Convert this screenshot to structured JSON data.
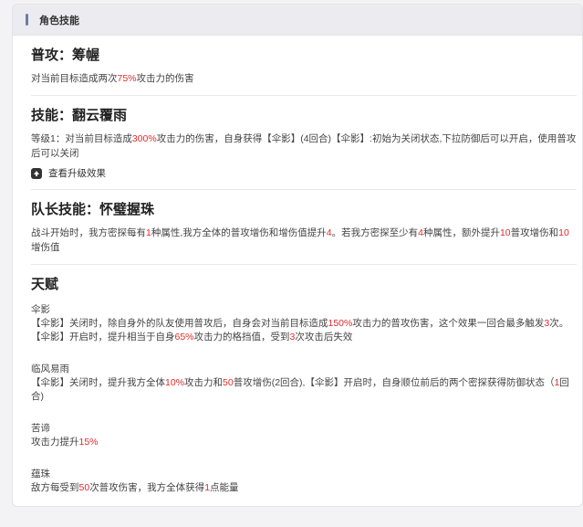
{
  "header": {
    "title": "角色技能"
  },
  "colors": {
    "highlight": "#e02b2b",
    "header_bar": "#6d7ca6"
  },
  "normal_attack": {
    "title": "普攻：筹幄",
    "desc": [
      "对当前目标造成两次",
      "75%",
      "攻击力的伤害"
    ]
  },
  "skill": {
    "title": "技能：翻云覆雨",
    "desc": [
      "等级1：对当前目标造成",
      "300%",
      "攻击力的伤害，自身获得【伞影】(4回合)【伞影】:初始为关闭状态,下拉防御后可以开启，使用普攻后可以关闭"
    ],
    "upgrade_label": "查看升级效果",
    "upgrade_icon": "arrow-up-icon"
  },
  "leader": {
    "title": "队长技能：怀璧握珠",
    "desc": [
      "战斗开始时，我方密探每有",
      "1",
      "种属性,我方全体的普攻增伤和增伤值提升",
      "4",
      "。若我方密探至少有",
      "4",
      "种属性，额外提升",
      "10",
      "普攻增伤和",
      "10",
      "增伤值"
    ]
  },
  "talents": {
    "title": "天赋",
    "items": [
      {
        "name": "伞影",
        "line1": [
          "【伞影】关闭时，除自身外的队友使用普攻后，自身会对当前目标造成",
          "150%",
          "攻击力的普攻伤害，这个效果一回合最多触发",
          "3",
          "次。"
        ],
        "line2": [
          "【伞影】开启时，提升相当于自身",
          "65%",
          "攻击力的格挡值，受到",
          "3",
          "次攻击后失效"
        ]
      },
      {
        "name": "临风易雨",
        "line1": [
          "【伞影】关闭时，提升我方全体",
          "10%",
          "攻击力和",
          "50",
          "普攻增伤(2回合),【伞影】开启时，自身顺位前后的两个密探获得防御状态（",
          "1",
          "回合)"
        ]
      },
      {
        "name": "苦谛",
        "line1": [
          "攻击力提升",
          "15%"
        ]
      },
      {
        "name": "蕴珠",
        "line1": [
          "敌方每受到",
          "50",
          "次普攻伤害，我方全体获得",
          "1",
          "点能量"
        ]
      }
    ]
  }
}
